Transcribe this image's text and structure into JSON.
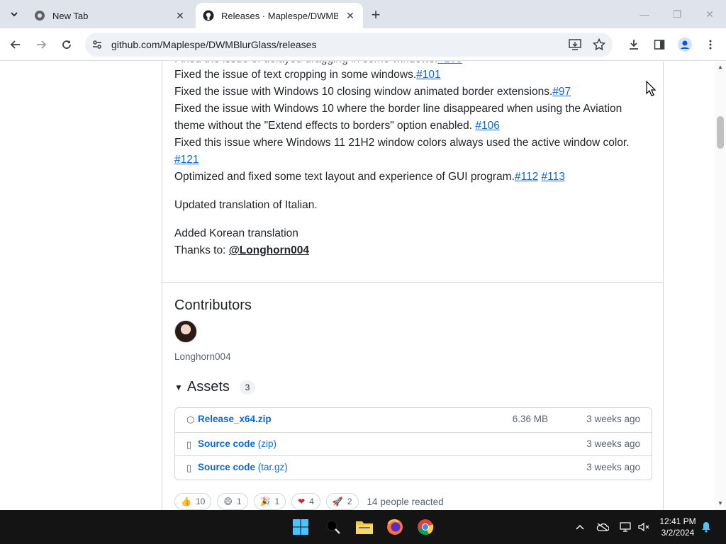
{
  "tabs": [
    {
      "title": "New Tab",
      "icon": "chrome-icon"
    },
    {
      "title": "Releases · Maplespe/DWMBlurGlass",
      "icon": "github-icon"
    }
  ],
  "omnibox": {
    "url": "github.com/Maplespe/DWMBlurGlass/releases"
  },
  "release_notes": [
    {
      "text": "Fixed the issue of text cropping in some windows.",
      "links": [
        "#101"
      ]
    },
    {
      "text": "Fixed the issue with Windows 10 closing window animated border extensions.",
      "links": [
        "#97"
      ]
    },
    {
      "text": "Fixed the issue with Windows 10 where the border line disappeared when using the Aviation",
      "links": []
    },
    {
      "text": "theme without the \"Extend effects to borders\" option enabled. ",
      "links": [
        "#106"
      ]
    },
    {
      "text": "Fixed this issue where Windows 11 21H2 window colors always used the active window color.",
      "links": []
    },
    {
      "text": "",
      "links": [
        "#121"
      ]
    },
    {
      "text": "Optimized and fixed some text layout and experience of GUI program.",
      "links": [
        "#112",
        "#113"
      ]
    }
  ],
  "notes_extra": {
    "italian": "Updated translation of Italian.",
    "korean": "Added Korean translation",
    "thanks_prefix": "Thanks to: ",
    "thanks_user": "@Longhorn004"
  },
  "contributors": {
    "heading": "Contributors",
    "names": [
      "Longhorn004"
    ]
  },
  "assets": {
    "heading": "Assets",
    "count": "3",
    "items": [
      {
        "name": "Release_x64.zip",
        "ext": "",
        "size": "6.36 MB",
        "date": "3 weeks ago",
        "icon": "package-icon"
      },
      {
        "name": "Source code",
        "ext": " (zip)",
        "size": "",
        "date": "3 weeks ago",
        "icon": "file-zip-icon"
      },
      {
        "name": "Source code",
        "ext": " (tar.gz)",
        "size": "",
        "date": "3 weeks ago",
        "icon": "file-zip-icon"
      }
    ]
  },
  "reactions": {
    "items": [
      {
        "emoji": "👍",
        "count": "10",
        "icon": "thumbs-up-icon"
      },
      {
        "emoji": "😄",
        "count": "1",
        "icon": "smile-icon"
      },
      {
        "emoji": "🎉",
        "count": "1",
        "icon": "hooray-icon"
      },
      {
        "emoji": "❤",
        "count": "4",
        "icon": "heart-icon"
      },
      {
        "emoji": "🚀",
        "count": "2",
        "icon": "rocket-icon"
      }
    ],
    "summary": "14 people reacted"
  },
  "taskbar": {
    "time": "12:41 PM",
    "date": "3/2/2024"
  },
  "colors": {
    "link": "#0969da",
    "text": "#1f2328",
    "muted": "#59636e",
    "tabstrip": "#dfe3eb"
  }
}
